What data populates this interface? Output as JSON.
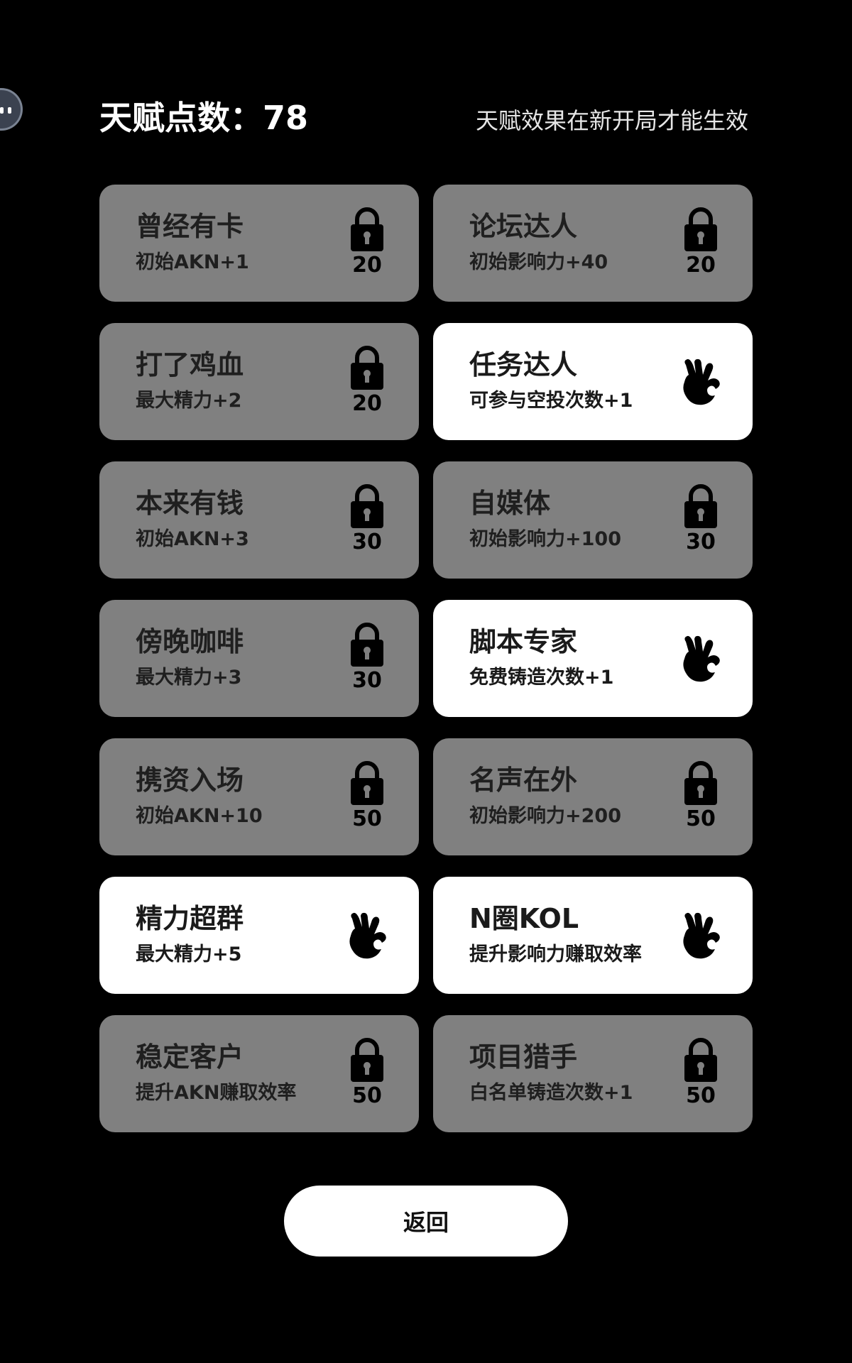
{
  "header": {
    "points_label": "天赋点数：78",
    "notice": "天赋效果在新开局才能生效"
  },
  "talents": [
    {
      "name": "曾经有卡",
      "desc": "初始AKN+1",
      "cost": "20",
      "state": "locked"
    },
    {
      "name": "论坛达人",
      "desc": "初始影响力+40",
      "cost": "20",
      "state": "locked"
    },
    {
      "name": "打了鸡血",
      "desc": "最大精力+2",
      "cost": "20",
      "state": "locked"
    },
    {
      "name": "任务达人",
      "desc": "可参与空投次数+1",
      "cost": "",
      "state": "unlocked"
    },
    {
      "name": "本来有钱",
      "desc": "初始AKN+3",
      "cost": "30",
      "state": "locked"
    },
    {
      "name": "自媒体",
      "desc": "初始影响力+100",
      "cost": "30",
      "state": "locked"
    },
    {
      "name": "傍晚咖啡",
      "desc": "最大精力+3",
      "cost": "30",
      "state": "locked"
    },
    {
      "name": "脚本专家",
      "desc": "免费铸造次数+1",
      "cost": "",
      "state": "unlocked"
    },
    {
      "name": "携资入场",
      "desc": "初始AKN+10",
      "cost": "50",
      "state": "locked"
    },
    {
      "name": "名声在外",
      "desc": "初始影响力+200",
      "cost": "50",
      "state": "locked"
    },
    {
      "name": "精力超群",
      "desc": "最大精力+5",
      "cost": "",
      "state": "unlocked"
    },
    {
      "name": "N圈KOL",
      "desc": "提升影响力赚取效率",
      "cost": "",
      "state": "unlocked"
    },
    {
      "name": "稳定客户",
      "desc": "提升AKN赚取效率",
      "cost": "50",
      "state": "locked"
    },
    {
      "name": "项目猎手",
      "desc": "白名单铸造次数+1",
      "cost": "50",
      "state": "locked"
    }
  ],
  "icons": {
    "locked": "lock-icon",
    "unlocked": "ok-hand-icon",
    "floating": "assistant-bubble-icon"
  },
  "colors": {
    "background": "#000000",
    "locked_card": "#808080",
    "unlocked_card": "#ffffff"
  },
  "footer": {
    "back_label": "返回"
  }
}
